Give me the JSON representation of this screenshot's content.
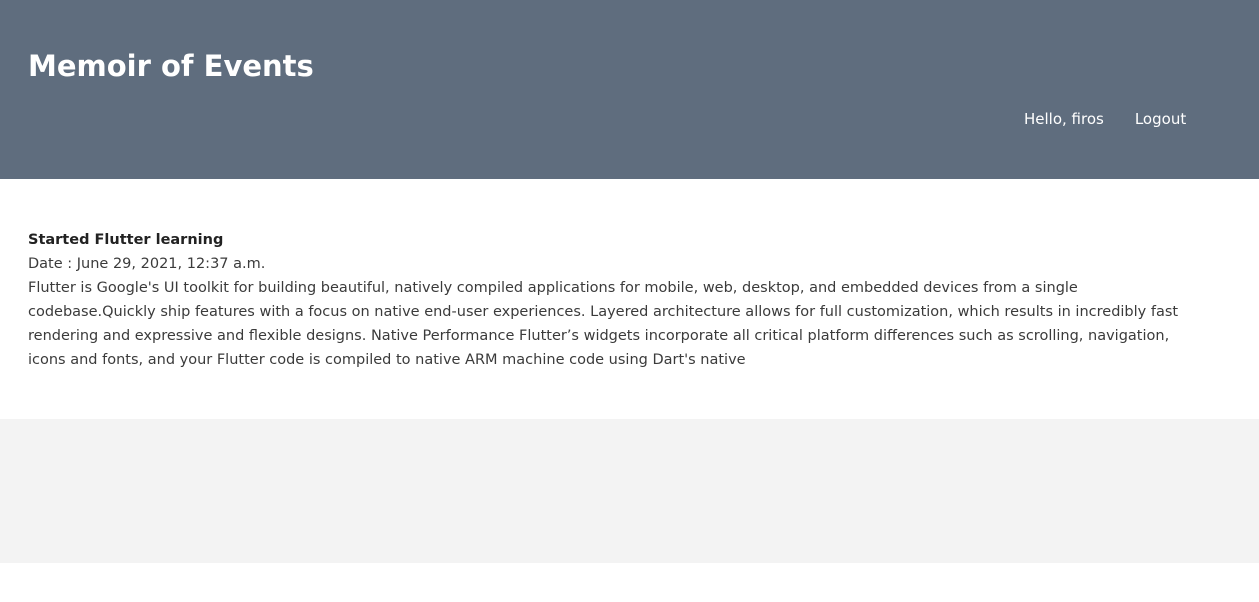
{
  "header": {
    "site_title": "Memoir of Events",
    "greeting": "Hello, firos",
    "logout_label": "Logout",
    "background_color": "#5f6d7e"
  },
  "event": {
    "title": "Started Flutter learning",
    "date": "Date : June 29, 2021, 12:37 a.m.",
    "description": "Flutter is Google's UI toolkit for building beautiful, natively compiled applications for mobile, web, desktop, and embedded devices from a single codebase.Quickly ship features with a focus on native end-user experiences. Layered architecture allows for full customization, which results in incredibly fast rendering and expressive and flexible designs. Native Performance Flutter’s widgets incorporate all critical platform differences such as scrolling, navigation, icons and fonts, and your Flutter code is compiled to native ARM machine code using Dart's native"
  },
  "footer": {
    "background_color": "#f3f3f3"
  }
}
